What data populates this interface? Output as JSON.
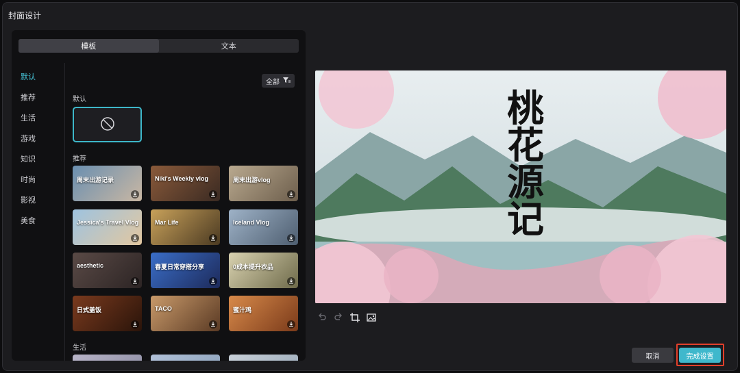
{
  "window": {
    "title": "封面设计"
  },
  "tabs": [
    {
      "label": "模板",
      "active": true
    },
    {
      "label": "文本",
      "active": false
    }
  ],
  "categories": [
    {
      "label": "默认",
      "active": true
    },
    {
      "label": "推荐"
    },
    {
      "label": "生活"
    },
    {
      "label": "游戏"
    },
    {
      "label": "知识"
    },
    {
      "label": "时尚"
    },
    {
      "label": "影视"
    },
    {
      "label": "美食"
    }
  ],
  "filter": {
    "label": "全部",
    "icon": "filter-icon"
  },
  "sections": {
    "default": "默认",
    "recommended": "推荐",
    "life": "生活"
  },
  "templates": [
    {
      "caption": "周末出游记录",
      "colors": [
        "#6a8fb0",
        "#c9b7a3"
      ]
    },
    {
      "caption": "Niki's Weekly vlog",
      "colors": [
        "#8a5a3a",
        "#3a2a22"
      ]
    },
    {
      "caption": "周末出游vlog",
      "colors": [
        "#b9a98f",
        "#6d5e4c"
      ]
    },
    {
      "caption": "Jessica's Travel Vlog",
      "colors": [
        "#9ec3e0",
        "#e2c7a0"
      ]
    },
    {
      "caption": "Mar Life",
      "colors": [
        "#c8a15a",
        "#4b3a22"
      ]
    },
    {
      "caption": "Iceland Vlog",
      "colors": [
        "#9eb2c7",
        "#4e5e70"
      ]
    },
    {
      "caption": "aesthetic",
      "colors": [
        "#5a4a46",
        "#2c2424"
      ]
    },
    {
      "caption": "春夏日常穿搭分享",
      "colors": [
        "#3a6ec8",
        "#1d2a5a"
      ]
    },
    {
      "caption": "0成本提升衣品",
      "colors": [
        "#d9d2b0",
        "#6e6a4a"
      ]
    },
    {
      "caption": "日式盖饭",
      "colors": [
        "#7a3a1e",
        "#2a140a"
      ]
    },
    {
      "caption": "TACO",
      "colors": [
        "#c99a6a",
        "#5a3a24"
      ]
    },
    {
      "caption": "蜜汁鸡",
      "colors": [
        "#d88a4a",
        "#7a3a1a"
      ]
    },
    {
      "caption": "",
      "colors": [
        "#b8b4c8",
        "#8a8aa0"
      ]
    },
    {
      "caption": "",
      "colors": [
        "#b0c0d8",
        "#8aa0b8"
      ]
    },
    {
      "caption": "",
      "colors": [
        "#c8d0d8",
        "#98a8b8"
      ]
    }
  ],
  "preview": {
    "title_chars": [
      "桃",
      "花",
      "源",
      "记"
    ],
    "colors": {
      "sky": "#dfe6ea",
      "mountain": "#6f8f86",
      "blossom": "#f2c6d4",
      "water": "#b9cfd3"
    }
  },
  "toolbar": [
    {
      "name": "undo-icon"
    },
    {
      "name": "redo-icon"
    },
    {
      "name": "crop-icon"
    },
    {
      "name": "replace-image-icon"
    }
  ],
  "buttons": {
    "cancel": "取消",
    "confirm": "完成设置"
  },
  "accent": "#3fb8cc"
}
